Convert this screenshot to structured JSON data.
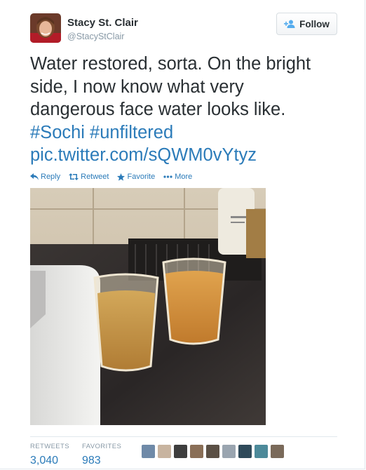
{
  "user": {
    "name": "Stacy St. Clair",
    "handle": "@StacyStClair",
    "follow_label": "Follow"
  },
  "tweet": {
    "lines": [
      "Water restored, sorta. On the bright",
      "side, I now know what very",
      "dangerous face water looks like."
    ],
    "hashtags": "#Sochi #unfiltered",
    "link": "pic.twitter.com/sQWM0vYtyz"
  },
  "actions": {
    "reply": "Reply",
    "retweet": "Retweet",
    "favorite": "Favorite",
    "more": "More"
  },
  "stats": {
    "retweets_label": "RETWEETS",
    "retweets_value": "3,040",
    "favorites_label": "FAVORITES",
    "favorites_value": "983"
  },
  "favoriters_count": 9,
  "colors": {
    "link": "#2b7bb9",
    "muted": "#8899a6",
    "text": "#292f33"
  }
}
